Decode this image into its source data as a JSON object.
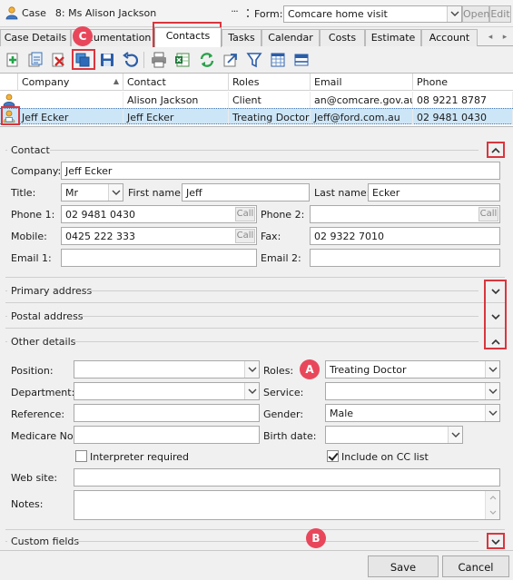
{
  "titlebar": {
    "case_label": "Case",
    "case_text": "8: Ms Alison Jackson",
    "more_label": "···",
    "form_label": "Form:",
    "form_value": "Comcare home visit",
    "open_label": "Open",
    "edit_label": "Edit"
  },
  "tabs": [
    "Case Details",
    "Documentation",
    "Contacts",
    "Tasks",
    "Calendar",
    "Costs",
    "Estimate",
    "Account"
  ],
  "active_tab": "Contacts",
  "grid": {
    "headers": [
      "Company",
      "Contact",
      "Roles",
      "Email",
      "Phone"
    ],
    "rows": [
      {
        "company": "",
        "contact": "Alison Jackson",
        "roles": "Client",
        "email": "an@comcare.gov.au",
        "phone": "08 9221 8787"
      },
      {
        "company": "Jeff Ecker",
        "contact": "Jeff Ecker",
        "roles": "Treating Doctor",
        "email": "Jeff@ford.com.au",
        "phone": "02 9481 0430"
      }
    ]
  },
  "contact": {
    "section_title": "Contact",
    "company_label": "Company:",
    "company_value": "Jeff Ecker",
    "title_label": "Title:",
    "title_value": "Mr",
    "first_name_label": "First name:",
    "first_name_value": "Jeff",
    "last_name_label": "Last name:",
    "last_name_value": "Ecker",
    "phone1_label": "Phone 1:",
    "phone1_value": "02 9481 0430",
    "phone2_label": "Phone 2:",
    "phone2_value": "",
    "mobile_label": "Mobile:",
    "mobile_value": "0425 222 333",
    "fax_label": "Fax:",
    "fax_value": "02 9322 7010",
    "email1_label": "Email 1:",
    "email1_value": "",
    "email2_label": "Email 2:",
    "email2_value": "",
    "call_label": "Call"
  },
  "sections": {
    "primary_address": "Primary address",
    "postal_address": "Postal address",
    "other_details": "Other details",
    "custom_fields": "Custom fields"
  },
  "other": {
    "position_label": "Position:",
    "position_value": "",
    "roles_label": "Roles:",
    "roles_value": "Treating Doctor",
    "department_label": "Department:",
    "department_value": "",
    "service_label": "Service:",
    "service_value": "",
    "reference_label": "Reference:",
    "reference_value": "",
    "gender_label": "Gender:",
    "gender_value": "Male",
    "medicare_label": "Medicare No:",
    "medicare_value": "",
    "birth_date_label": "Birth date:",
    "birth_date_value": "",
    "interpreter_label": "Interpreter required",
    "interpreter_checked": false,
    "cc_label": "Include on CC list",
    "cc_checked": true,
    "website_label": "Web site:",
    "website_value": "",
    "notes_label": "Notes:",
    "notes_value": ""
  },
  "callouts": {
    "a": "A",
    "b": "B",
    "c": "C"
  },
  "buttons": {
    "save": "Save",
    "cancel": "Cancel"
  },
  "colors": {
    "annotation_red": "#d9363e",
    "callout_pink": "#e8475b",
    "selection_blue": "#cde6f7"
  }
}
